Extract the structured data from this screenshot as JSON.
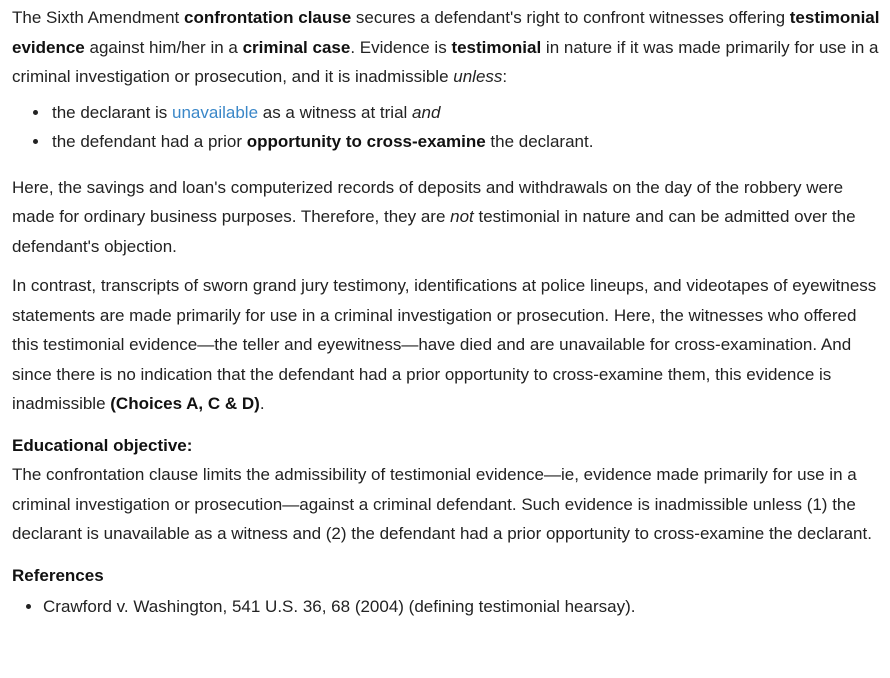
{
  "intro": {
    "t1": "The Sixth Amendment ",
    "b1": "confrontation clause",
    "t2": " secures a defendant's right to confront witnesses offering ",
    "b2": "testimonial evidence",
    "t3": " against him/her in a ",
    "b3": "criminal case",
    "t4": ".  Evidence is ",
    "b4": "testimonial",
    "t5": " in nature if it was made primarily for use in a criminal investigation or prosecution, and it is inadmissible ",
    "i1": "unless",
    "t6": ":"
  },
  "bullets": {
    "item1": {
      "t1": "the declarant is ",
      "link": "unavailable",
      "t2": " as a witness at trial ",
      "i1": "and"
    },
    "item2": {
      "t1": "the defendant had a prior ",
      "b1": "opportunity to cross-examine",
      "t2": " the declarant."
    }
  },
  "para2": {
    "t1": "Here, the savings and loan's computerized records of deposits and withdrawals on the day of the robbery were made for ordinary business purposes.  Therefore, they are ",
    "i1": "not",
    "t2": " testimonial in nature and can be admitted over the defendant's objection."
  },
  "para3": {
    "t1": "In contrast, transcripts of sworn grand jury testimony, identifications at police lineups, and videotapes of eyewitness statements are made primarily for use in a criminal investigation or prosecution.  Here, the witnesses who offered this testimonial evidence—the teller and eyewitness—have died and are unavailable for cross-examination.  And since there is no indication that the defendant had a prior opportunity to cross-examine them, this evidence is inadmissible ",
    "b1": "(Choices A, C & D)",
    "t2": "."
  },
  "objective": {
    "heading": "Educational objective:",
    "text": "The confrontation clause limits the admissibility of testimonial evidence—ie, evidence made primarily for use in a criminal investigation or prosecution—against a criminal defendant.  Such evidence is inadmissible unless (1) the declarant is unavailable as a witness and (2) the defendant had a prior opportunity to cross-examine the declarant."
  },
  "references": {
    "heading": "References",
    "items": [
      "Crawford v. Washington, 541 U.S. 36, 68 (2004) (defining testimonial hearsay)."
    ]
  },
  "colors": {
    "text": "#222222",
    "link": "#3a87c8",
    "background": "#ffffff"
  }
}
